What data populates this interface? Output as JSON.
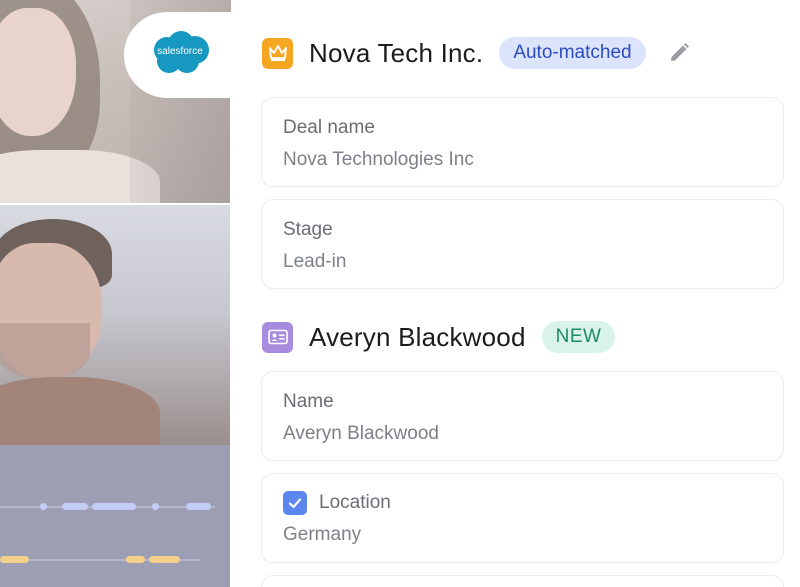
{
  "crm": {
    "logo_text": "salesforce",
    "brand_color": "#1798c1"
  },
  "company": {
    "icon": "crown-icon",
    "title": "Nova Tech Inc.",
    "badge": "Auto-matched",
    "edit_icon": "pencil-icon",
    "fields": [
      {
        "label": "Deal name",
        "value": "Nova Technologies Inc"
      },
      {
        "label": "Stage",
        "value": "Lead-in"
      }
    ]
  },
  "contact": {
    "icon": "contact-card-icon",
    "title": "Averyn Blackwood",
    "badge": "NEW",
    "fields": [
      {
        "label": "Name",
        "value": "Averyn Blackwood"
      },
      {
        "label": "Location",
        "value": "Germany",
        "checked": true
      }
    ]
  },
  "colors": {
    "matched_badge_bg": "#dbe4fb",
    "matched_badge_text": "#2d4cc0",
    "new_badge_bg": "#d9f3ea",
    "new_badge_text": "#1c8a67",
    "company_icon_bg": "#f5a623",
    "contact_icon_bg": "#a78bdf",
    "checkbox": "#5b86ee"
  }
}
